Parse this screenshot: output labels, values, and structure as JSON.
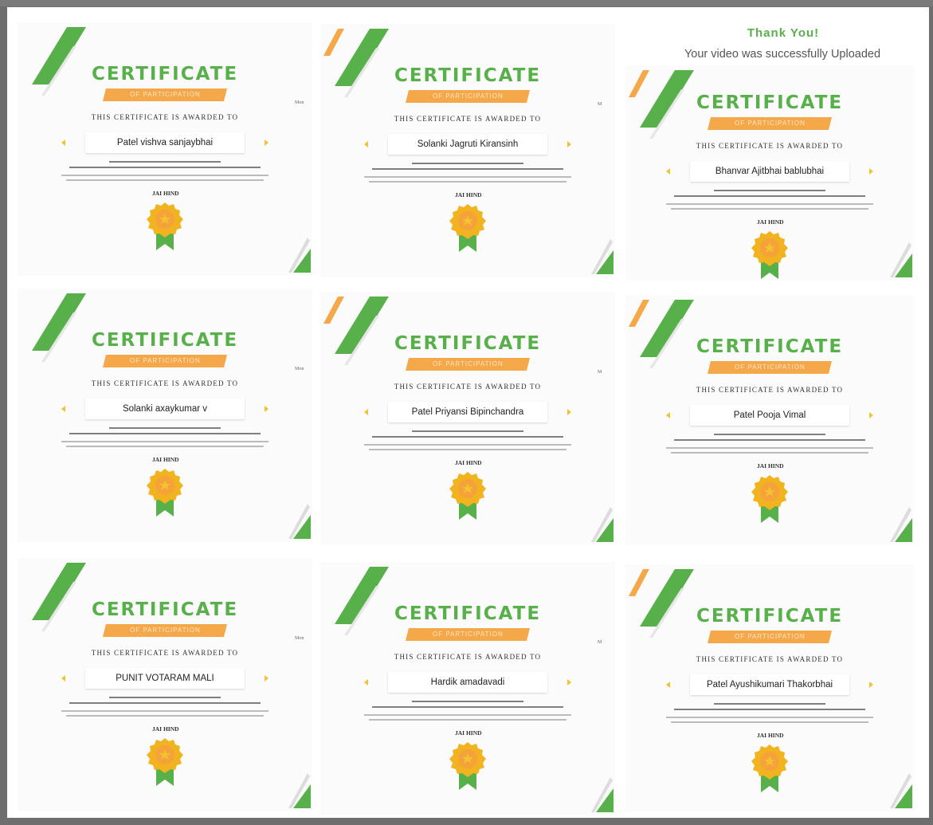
{
  "overlay": {
    "thank_title": "Thank You!",
    "thank_subtitle": "Your video was successfully Uploaded"
  },
  "certificate_text": {
    "title": "CERTIFICATE",
    "ribbon": "OF PARTICIPATION",
    "awarded_to": "THIS CERTIFICATE IS AWARDED TO",
    "closing": "JAI HIND"
  },
  "colors": {
    "green": "#58b04a",
    "orange": "#f4a84a",
    "medal_gold": "#f2b320",
    "frame": "#6e6e6e"
  },
  "certificates": [
    {
      "name": "Patel vishva sanjaybhai",
      "side_label": "Mon"
    },
    {
      "name": "Solanki Jagruti Kiransinh",
      "side_label": "M"
    },
    {
      "name": "Bhanvar Ajitbhai bablubhai",
      "side_label": ""
    },
    {
      "name": "Solanki axaykumar v",
      "side_label": "Mon"
    },
    {
      "name": "Patel Priyansi Bipinchandra",
      "side_label": "M"
    },
    {
      "name": "Patel Pooja Vimal",
      "side_label": ""
    },
    {
      "name": "PUNIT VOTARAM MALI",
      "side_label": "Mon"
    },
    {
      "name": "Hardik amadavadi",
      "side_label": "M"
    },
    {
      "name": "Patel Ayushikumari Thakorbhai",
      "side_label": ""
    }
  ]
}
